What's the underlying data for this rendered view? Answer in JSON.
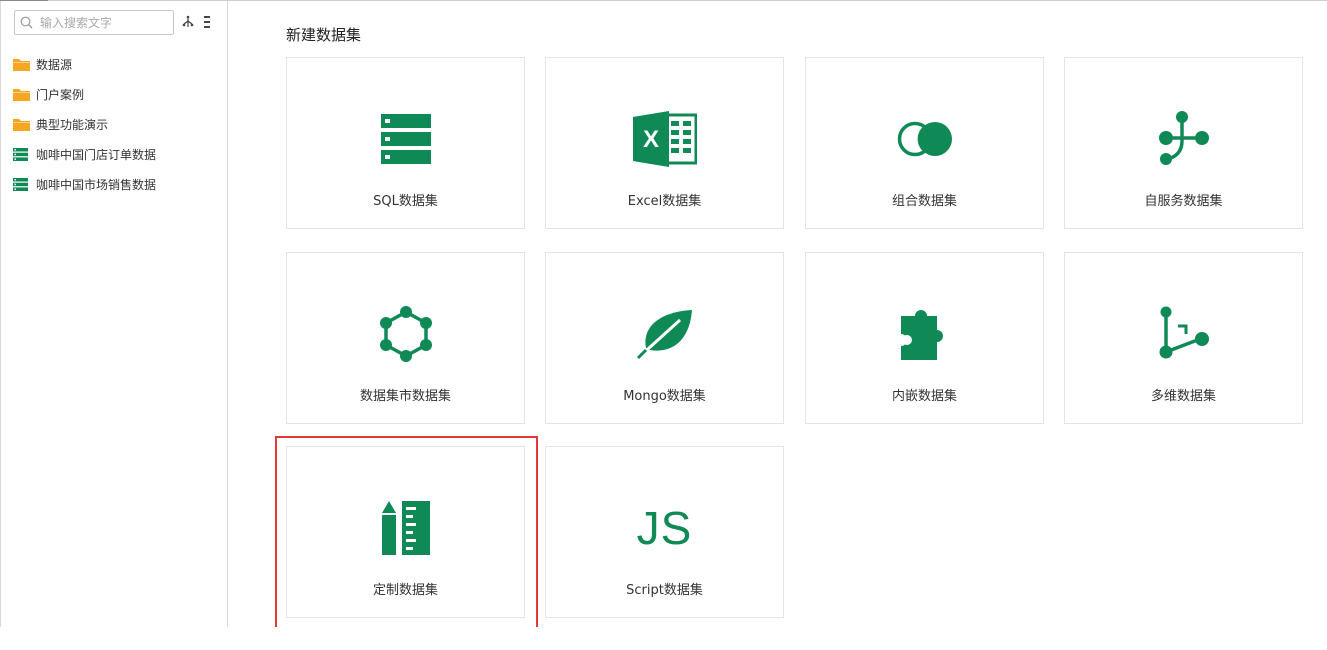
{
  "sidebar": {
    "search": {
      "placeholder": "输入搜索文字",
      "value": ""
    },
    "items": [
      {
        "label": "数据源",
        "icon": "folder-icon"
      },
      {
        "label": "门户案例",
        "icon": "folder-icon"
      },
      {
        "label": "典型功能演示",
        "icon": "folder-icon"
      },
      {
        "label": "咖啡中国门店订单数据",
        "icon": "dataset-icon"
      },
      {
        "label": "咖啡中国市场销售数据",
        "icon": "dataset-icon"
      }
    ]
  },
  "main": {
    "title": "新建数据集",
    "cards": [
      {
        "label": "SQL数据集",
        "icon": "sql-table-icon"
      },
      {
        "label": "Excel数据集",
        "icon": "excel-icon"
      },
      {
        "label": "组合数据集",
        "icon": "combine-circles-icon"
      },
      {
        "label": "自服务数据集",
        "icon": "self-service-tree-icon"
      },
      {
        "label": "数据集市数据集",
        "icon": "hexagon-nodes-icon"
      },
      {
        "label": "Mongo数据集",
        "icon": "leaf-icon"
      },
      {
        "label": "内嵌数据集",
        "icon": "puzzle-icon"
      },
      {
        "label": "多维数据集",
        "icon": "multidim-nodes-icon"
      },
      {
        "label": "定制数据集",
        "icon": "pencil-ruler-icon"
      },
      {
        "label": "Script数据集",
        "icon": "js-icon",
        "glyph": "JS"
      }
    ]
  },
  "colors": {
    "accent_green": "#0f8a57",
    "folder_orange": "#f5a623",
    "highlight_red": "#e53935"
  }
}
